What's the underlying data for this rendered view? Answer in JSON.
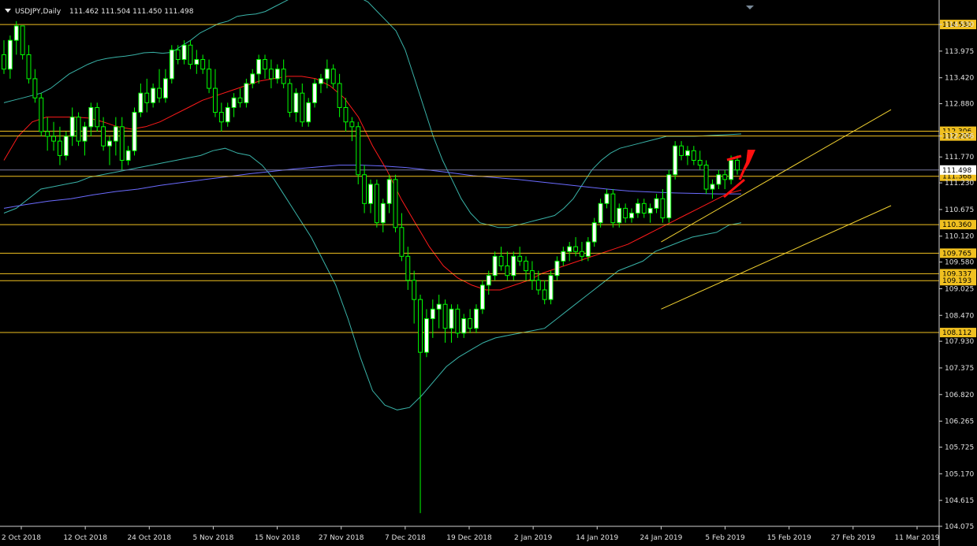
{
  "header": {
    "symbol_label": "USDJPY,Daily",
    "ohlc_text": "111.462 111.504 111.450 111.498"
  },
  "colors": {
    "background": "#000000",
    "bull_candle": "#ffffff",
    "bear_candle": "#000000",
    "candle_wick": "#00ff00",
    "bollinger": "#39b3a8",
    "sma_red": "#ff1a1a",
    "sma_blue": "#6b6bff",
    "level_line": "#f0c020",
    "channel": "#f0d030",
    "arrow": "#ff1010",
    "axis_text": "#e0e0e0"
  },
  "chart_data": {
    "type": "candlestick",
    "symbol": "USDJPY",
    "timeframe": "Daily",
    "y_ticks": [
      114.53,
      113.975,
      113.42,
      112.88,
      112.206,
      111.77,
      111.23,
      110.675,
      110.12,
      109.58,
      109.025,
      108.47,
      107.93,
      107.375,
      106.82,
      106.265,
      105.725,
      105.17,
      104.615,
      104.075
    ],
    "ylim": [
      104.075,
      115.04
    ],
    "x_ticks": [
      "2 Oct 2018",
      "12 Oct 2018",
      "24 Oct 2018",
      "5 Nov 2018",
      "15 Nov 2018",
      "27 Nov 2018",
      "7 Dec 2018",
      "19 Dec 2018",
      "2 Jan 2019",
      "14 Jan 2019",
      "24 Jan 2019",
      "5 Feb 2019",
      "15 Feb 2019",
      "27 Feb 2019",
      "11 Mar 2019"
    ],
    "price_levels": [
      {
        "label": "114.530",
        "value": 114.53
      },
      {
        "label": "112.306",
        "value": 112.306
      },
      {
        "label": "112.206",
        "value": 112.206
      },
      {
        "label": "111.368",
        "value": 111.368
      },
      {
        "label": "110.360",
        "value": 110.36
      },
      {
        "label": "109.765",
        "value": 109.765
      },
      {
        "label": "109.337",
        "value": 109.337
      },
      {
        "label": "109.193",
        "value": 109.193
      },
      {
        "label": "108.112",
        "value": 108.112
      }
    ],
    "current_price": {
      "label": "111.498",
      "value": 111.498
    },
    "candles": [
      [
        113.9,
        114.2,
        113.5,
        113.6
      ],
      [
        113.6,
        114.3,
        113.4,
        114.2
      ],
      [
        114.2,
        114.6,
        113.9,
        114.5
      ],
      [
        114.5,
        114.5,
        113.8,
        113.9
      ],
      [
        113.9,
        114.1,
        113.3,
        113.4
      ],
      [
        113.4,
        113.6,
        112.9,
        113.0
      ],
      [
        113.0,
        113.1,
        112.2,
        112.3
      ],
      [
        112.3,
        112.6,
        111.9,
        112.2
      ],
      [
        112.2,
        112.5,
        111.9,
        112.1
      ],
      [
        112.1,
        112.4,
        111.6,
        111.8
      ],
      [
        111.8,
        112.3,
        111.7,
        112.2
      ],
      [
        112.2,
        112.8,
        112.0,
        112.6
      ],
      [
        112.6,
        112.7,
        112.0,
        112.1
      ],
      [
        112.1,
        112.5,
        111.8,
        112.4
      ],
      [
        112.4,
        112.9,
        112.2,
        112.8
      ],
      [
        112.8,
        112.9,
        112.3,
        112.4
      ],
      [
        112.4,
        112.6,
        111.9,
        112.0
      ],
      [
        112.0,
        112.2,
        111.6,
        112.1
      ],
      [
        112.1,
        112.6,
        111.8,
        112.4
      ],
      [
        112.4,
        112.6,
        111.5,
        111.7
      ],
      [
        111.7,
        112.0,
        111.6,
        111.9
      ],
      [
        111.9,
        112.8,
        111.8,
        112.7
      ],
      [
        112.7,
        113.3,
        112.6,
        113.1
      ],
      [
        113.1,
        113.4,
        112.7,
        112.9
      ],
      [
        112.9,
        113.3,
        112.8,
        113.2
      ],
      [
        113.2,
        113.6,
        112.9,
        113.0
      ],
      [
        113.0,
        113.6,
        112.9,
        113.4
      ],
      [
        113.4,
        114.1,
        113.3,
        114.0
      ],
      [
        114.0,
        114.1,
        113.7,
        113.8
      ],
      [
        113.8,
        114.2,
        113.7,
        114.1
      ],
      [
        114.1,
        114.2,
        113.6,
        113.7
      ],
      [
        113.7,
        114.0,
        113.5,
        113.8
      ],
      [
        113.8,
        113.9,
        113.5,
        113.6
      ],
      [
        113.6,
        113.8,
        113.1,
        113.2
      ],
      [
        113.2,
        113.6,
        112.6,
        112.7
      ],
      [
        112.7,
        112.9,
        112.3,
        112.5
      ],
      [
        112.5,
        112.9,
        112.4,
        112.8
      ],
      [
        112.8,
        113.1,
        112.6,
        113.0
      ],
      [
        113.0,
        113.2,
        112.8,
        112.9
      ],
      [
        112.9,
        113.4,
        112.8,
        113.3
      ],
      [
        113.3,
        113.6,
        113.2,
        113.5
      ],
      [
        113.5,
        113.9,
        113.3,
        113.8
      ],
      [
        113.8,
        113.9,
        113.4,
        113.6
      ],
      [
        113.6,
        113.8,
        113.2,
        113.4
      ],
      [
        113.4,
        113.7,
        113.3,
        113.6
      ],
      [
        113.6,
        113.8,
        113.2,
        113.3
      ],
      [
        113.3,
        113.4,
        112.6,
        112.7
      ],
      [
        112.7,
        113.2,
        112.5,
        113.1
      ],
      [
        113.1,
        113.3,
        112.4,
        112.5
      ],
      [
        112.5,
        113.0,
        112.4,
        112.9
      ],
      [
        112.9,
        113.4,
        112.8,
        113.3
      ],
      [
        113.3,
        113.5,
        113.1,
        113.4
      ],
      [
        113.4,
        113.8,
        113.2,
        113.6
      ],
      [
        113.6,
        113.7,
        113.2,
        113.3
      ],
      [
        113.3,
        113.5,
        112.6,
        112.8
      ],
      [
        112.8,
        113.0,
        112.3,
        112.5
      ],
      [
        112.5,
        112.6,
        112.1,
        112.4
      ],
      [
        112.4,
        112.5,
        111.2,
        111.4
      ],
      [
        111.4,
        111.6,
        110.6,
        110.8
      ],
      [
        110.8,
        111.3,
        110.6,
        111.2
      ],
      [
        111.2,
        111.3,
        110.3,
        110.4
      ],
      [
        110.4,
        110.9,
        110.2,
        110.8
      ],
      [
        110.8,
        111.4,
        110.6,
        111.3
      ],
      [
        111.3,
        111.4,
        110.2,
        110.3
      ],
      [
        110.3,
        110.6,
        109.6,
        109.7
      ],
      [
        109.7,
        109.9,
        109.0,
        109.2
      ],
      [
        109.2,
        109.4,
        108.3,
        108.8
      ],
      [
        108.8,
        108.9,
        104.35,
        107.7
      ],
      [
        107.7,
        108.6,
        107.6,
        108.4
      ],
      [
        108.4,
        108.8,
        108.0,
        108.6
      ],
      [
        108.6,
        108.9,
        108.2,
        108.7
      ],
      [
        108.7,
        108.8,
        107.9,
        108.2
      ],
      [
        108.2,
        108.7,
        107.9,
        108.6
      ],
      [
        108.6,
        108.7,
        108.0,
        108.1
      ],
      [
        108.1,
        108.5,
        108.0,
        108.4
      ],
      [
        108.4,
        108.6,
        108.1,
        108.2
      ],
      [
        108.2,
        108.7,
        108.1,
        108.6
      ],
      [
        108.6,
        109.2,
        108.5,
        109.1
      ],
      [
        109.1,
        109.4,
        108.9,
        109.3
      ],
      [
        109.3,
        109.8,
        109.2,
        109.7
      ],
      [
        109.7,
        109.9,
        109.4,
        109.5
      ],
      [
        109.5,
        109.8,
        109.2,
        109.3
      ],
      [
        109.3,
        109.8,
        109.2,
        109.7
      ],
      [
        109.7,
        109.9,
        109.5,
        109.6
      ],
      [
        109.6,
        109.7,
        109.2,
        109.4
      ],
      [
        109.4,
        109.6,
        109.0,
        109.2
      ],
      [
        109.2,
        109.4,
        108.9,
        109.0
      ],
      [
        109.0,
        109.2,
        108.7,
        108.8
      ],
      [
        108.8,
        109.4,
        108.7,
        109.3
      ],
      [
        109.3,
        109.7,
        109.2,
        109.6
      ],
      [
        109.6,
        109.9,
        109.5,
        109.8
      ],
      [
        109.8,
        110.0,
        109.6,
        109.9
      ],
      [
        109.9,
        110.1,
        109.7,
        109.8
      ],
      [
        109.8,
        110.0,
        109.6,
        109.7
      ],
      [
        109.7,
        110.1,
        109.6,
        110.0
      ],
      [
        110.0,
        110.5,
        109.9,
        110.4
      ],
      [
        110.4,
        110.9,
        110.3,
        110.8
      ],
      [
        110.8,
        111.1,
        110.7,
        111.0
      ],
      [
        111.0,
        111.1,
        110.3,
        110.4
      ],
      [
        110.4,
        110.8,
        110.3,
        110.7
      ],
      [
        110.7,
        110.8,
        110.4,
        110.5
      ],
      [
        110.5,
        110.7,
        110.4,
        110.6
      ],
      [
        110.6,
        110.9,
        110.5,
        110.8
      ],
      [
        110.8,
        110.9,
        110.5,
        110.6
      ],
      [
        110.6,
        110.8,
        110.4,
        110.7
      ],
      [
        110.7,
        111.0,
        110.6,
        110.9
      ],
      [
        110.9,
        111.1,
        110.4,
        110.5
      ],
      [
        110.5,
        111.5,
        110.4,
        111.4
      ],
      [
        111.4,
        112.1,
        111.3,
        112.0
      ],
      [
        112.0,
        112.1,
        111.7,
        111.8
      ],
      [
        111.8,
        112.0,
        111.6,
        111.9
      ],
      [
        111.9,
        112.0,
        111.6,
        111.7
      ],
      [
        111.7,
        111.9,
        111.5,
        111.6
      ],
      [
        111.6,
        111.7,
        111.0,
        111.1
      ],
      [
        111.1,
        111.3,
        110.9,
        111.2
      ],
      [
        111.2,
        111.5,
        111.1,
        111.4
      ],
      [
        111.4,
        111.5,
        111.1,
        111.3
      ],
      [
        111.3,
        111.8,
        111.2,
        111.7
      ],
      [
        111.7,
        111.8,
        111.4,
        111.5
      ]
    ],
    "series": [
      {
        "name": "",
        "kind": "bollinger_upper",
        "values": [
          112.9,
          112.95,
          113.0,
          113.05,
          113.1,
          113.2,
          113.35,
          113.5,
          113.6,
          113.7,
          113.78,
          113.82,
          113.85,
          113.87,
          113.9,
          113.94,
          113.95,
          113.93,
          113.95,
          114.08,
          114.2,
          114.35,
          114.45,
          114.55,
          114.6,
          114.7,
          114.73,
          114.75,
          114.8,
          114.9,
          115.0,
          115.1,
          115.18,
          115.22,
          115.24,
          115.25,
          115.2,
          115.15,
          115.1,
          115.0,
          114.8,
          114.6,
          114.4,
          114.0,
          113.4,
          112.8,
          112.2,
          111.7,
          111.3,
          110.9,
          110.6,
          110.4,
          110.35,
          110.3,
          110.3,
          110.35,
          110.4,
          110.45,
          110.5,
          110.55,
          110.7,
          110.9,
          111.2,
          111.5,
          111.7,
          111.85,
          111.95,
          112.0,
          112.05,
          112.1,
          112.15,
          112.2,
          112.2,
          112.2,
          112.2,
          112.21,
          112.22,
          112.23,
          112.24,
          112.25
        ]
      },
      {
        "name": "",
        "kind": "bollinger_lower",
        "values": [
          110.6,
          110.7,
          110.9,
          111.1,
          111.15,
          111.2,
          111.25,
          111.35,
          111.4,
          111.45,
          111.5,
          111.55,
          111.6,
          111.65,
          111.7,
          111.75,
          111.8,
          111.9,
          111.95,
          111.85,
          111.8,
          111.6,
          111.3,
          110.9,
          110.5,
          110.1,
          109.6,
          109.1,
          108.4,
          107.6,
          106.9,
          106.6,
          106.5,
          106.55,
          106.8,
          107.1,
          107.4,
          107.6,
          107.75,
          107.9,
          108.0,
          108.05,
          108.1,
          108.15,
          108.2,
          108.4,
          108.6,
          108.8,
          109.0,
          109.2,
          109.4,
          109.5,
          109.6,
          109.8,
          109.9,
          110.0,
          110.1,
          110.15,
          110.2,
          110.35,
          110.4
        ]
      },
      {
        "name": "",
        "kind": "sma_red",
        "values": [
          111.7,
          112.2,
          112.5,
          112.6,
          112.6,
          112.6,
          112.58,
          112.5,
          112.4,
          112.35,
          112.4,
          112.5,
          112.65,
          112.8,
          112.95,
          113.05,
          113.15,
          113.25,
          113.35,
          113.4,
          113.45,
          113.45,
          113.4,
          113.25,
          113.0,
          112.6,
          112.0,
          111.5,
          110.9,
          110.4,
          109.9,
          109.5,
          109.25,
          109.1,
          109.0,
          109.0,
          109.1,
          109.2,
          109.35,
          109.45,
          109.55,
          109.65,
          109.75,
          109.85,
          109.95,
          110.1,
          110.25,
          110.4,
          110.55,
          110.7,
          110.85,
          111.0,
          111.08
        ]
      },
      {
        "name": "",
        "kind": "sma_blue",
        "values": [
          110.7,
          110.78,
          110.85,
          110.9,
          110.98,
          111.05,
          111.1,
          111.18,
          111.24,
          111.3,
          111.36,
          111.42,
          111.47,
          111.52,
          111.56,
          111.6,
          111.6,
          111.58,
          111.55,
          111.5,
          111.44,
          111.38,
          111.34,
          111.3,
          111.25,
          111.2,
          111.15,
          111.1,
          111.06,
          111.04,
          111.02,
          111.01,
          111.0,
          111.0
        ]
      }
    ],
    "channel": {
      "upper": {
        "x": [
          "24 Jan 2019",
          "27 Feb 2019"
        ],
        "y": [
          110.0,
          112.3
        ]
      },
      "lower": {
        "x": [
          "24 Jan 2019",
          "11 Mar 2019"
        ],
        "y": [
          108.6,
          111.0
        ]
      }
    }
  }
}
